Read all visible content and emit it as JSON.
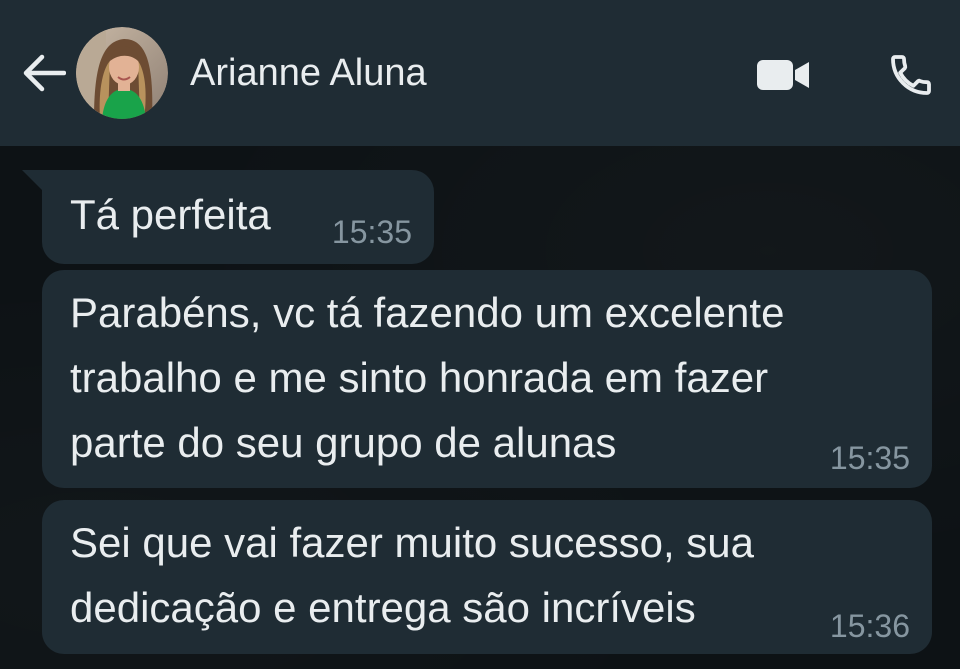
{
  "header": {
    "contact_name": "Arianne Aluna",
    "back_icon": "arrow-left-icon",
    "video_icon": "video-camera-icon",
    "call_icon": "phone-icon",
    "background_color": "#1f2c34"
  },
  "messages": [
    {
      "text": "Tá perfeita",
      "time": "15:35"
    },
    {
      "text": "Parabéns, vc tá fazendo um excelente\ntrabalho e me sinto honrada em fazer\nparte do seu grupo de alunas",
      "time": "15:35"
    },
    {
      "text": "Sei que vai fazer muito sucesso, sua\ndedicação e entrega são incríveis",
      "time": "15:36"
    }
  ],
  "colors": {
    "bubble": "#1f2c34",
    "text": "#e9edef",
    "timestamp": "#8696a0",
    "chat_background": "#0d1215"
  }
}
